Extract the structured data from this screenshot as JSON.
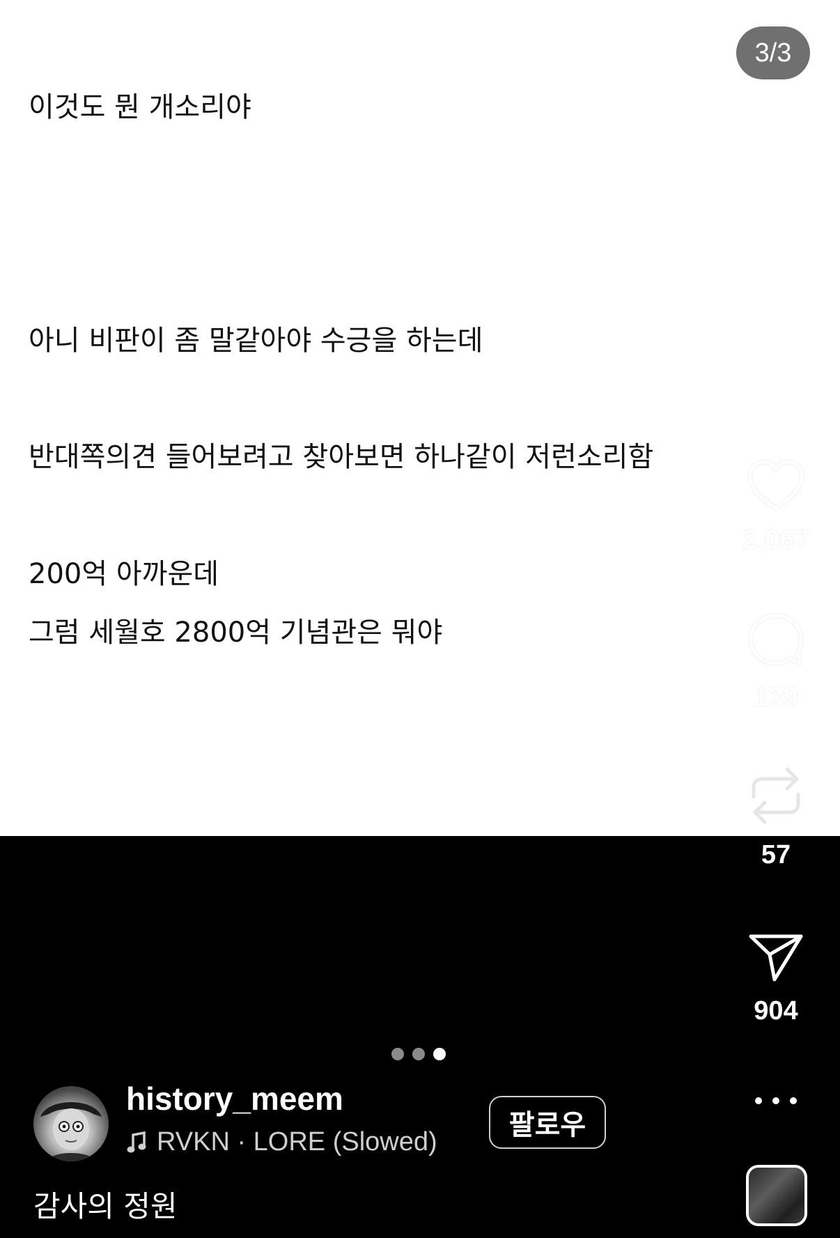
{
  "post": {
    "counter": "3/3",
    "lines": [
      "이것도 뭔 개소리야",
      "아니 비판이 좀 말같아야 수긍을 하는데",
      "반대쪽의견 들어보려고 찾아보면 하나같이 저런소리함",
      "200억 아까운데",
      "그럼 세월호 2800억 기념관은 뭐야"
    ]
  },
  "actions": {
    "like": {
      "icon": "heart-icon",
      "count": "2,067"
    },
    "comment": {
      "icon": "comment-bubble-icon",
      "count": "139"
    },
    "repost": {
      "icon": "repost-icon",
      "count": "57"
    },
    "share": {
      "icon": "send-icon",
      "count": "904"
    }
  },
  "carousel": {
    "total": 3,
    "active_index": 2
  },
  "author": {
    "username": "history_meem",
    "music": "RVKN · LORE (Slowed)",
    "follow_label": "팔로우"
  },
  "caption": "감사의 정원",
  "colors": {
    "background": "#000000",
    "post_background": "#ffffff",
    "badge": "#707070"
  }
}
